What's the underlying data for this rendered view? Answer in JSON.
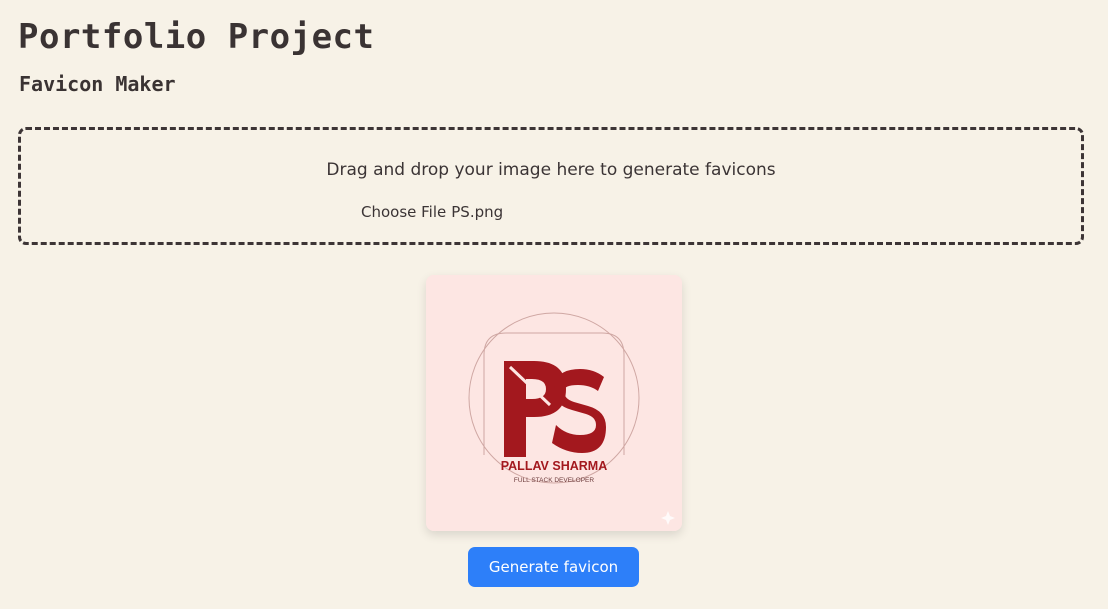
{
  "header": {
    "title": "Portfolio Project",
    "subtitle": "Favicon Maker"
  },
  "dropzone": {
    "instruction": "Drag and drop your image here to generate favicons",
    "choose_file_label": "Choose File",
    "file_name": "PS.png"
  },
  "preview": {
    "logo_monogram": "PS",
    "logo_name": "PALLAV SHARMA",
    "logo_tagline": "FULL STACK DEVELOPER",
    "brand_color": "#a3181e",
    "background_color": "#fde6e3"
  },
  "actions": {
    "generate_label": "Generate favicon",
    "generate_color": "#2d7ff9"
  },
  "icons": {
    "watermark": "sparkle-icon"
  }
}
